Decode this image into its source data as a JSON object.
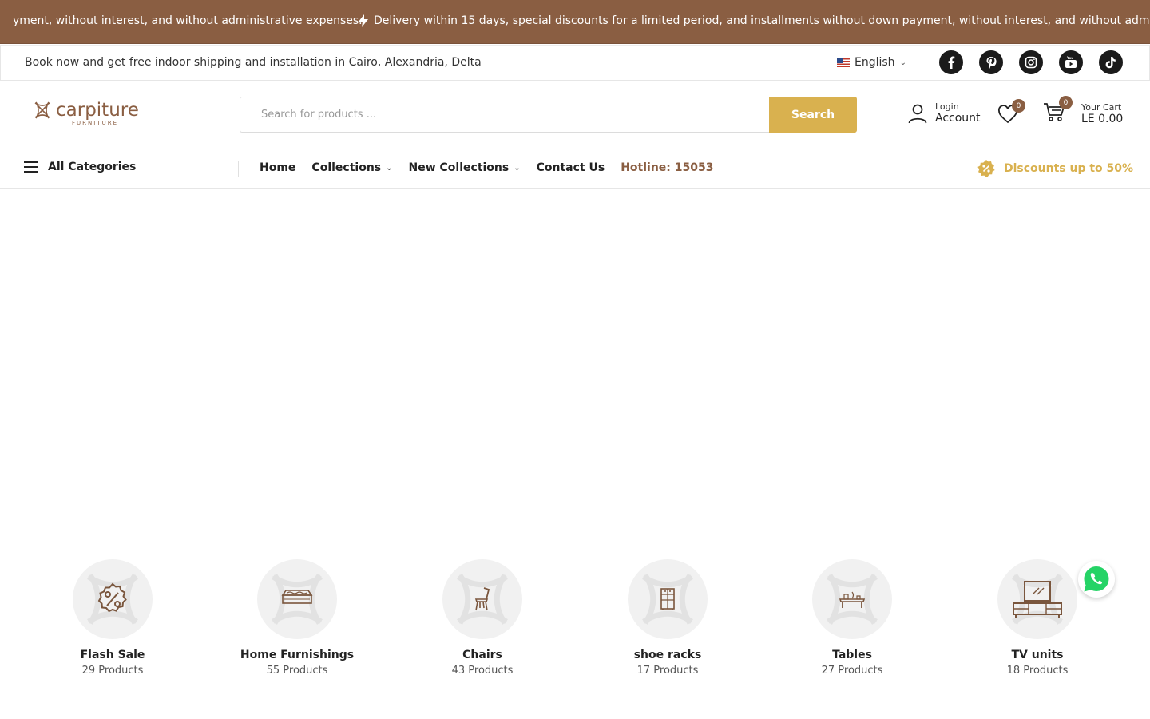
{
  "ticker": {
    "text_left": "yment, without interest, and without administrative expenses.",
    "text_right": "Delivery within 15 days, special discounts for a limited period, and installments without down payment, without interest, and without administrative"
  },
  "topbar": {
    "message": "Book now and get free indoor shipping and installation in Cairo, Alexandria, Delta",
    "language": "English",
    "socials": [
      "facebook-icon",
      "pinterest-icon",
      "instagram-icon",
      "youtube-icon",
      "tiktok-icon"
    ]
  },
  "header": {
    "logo_text": "carpiture",
    "logo_sub": "FURNITURE",
    "search_placeholder": "Search for products ...",
    "search_button": "Search",
    "account_line1": "Login",
    "account_line2": "Account",
    "wishlist_count": "0",
    "cart_count": "0",
    "cart_line1": "Your Cart",
    "cart_total": "LE 0.00"
  },
  "nav": {
    "all_categories": "All Categories",
    "items": [
      {
        "label": "Home",
        "dropdown": false
      },
      {
        "label": "Collections",
        "dropdown": true
      },
      {
        "label": "New Collections",
        "dropdown": true
      },
      {
        "label": "Contact Us",
        "dropdown": false
      },
      {
        "label": "Hotline: 15053",
        "dropdown": false
      }
    ],
    "discount": "Discounts up to 50%"
  },
  "categories": [
    {
      "name": "Flash Sale",
      "count": "29 Products",
      "icon": "percent-badge-icon"
    },
    {
      "name": "Home Furnishings",
      "count": "55 Products",
      "icon": "mattress-icon"
    },
    {
      "name": "Chairs",
      "count": "43 Products",
      "icon": "chair-icon"
    },
    {
      "name": "shoe racks",
      "count": "17 Products",
      "icon": "shoe-rack-icon"
    },
    {
      "name": "Tables",
      "count": "27 Products",
      "icon": "table-icon"
    },
    {
      "name": "TV units",
      "count": "18 Products",
      "icon": "tv-unit-icon"
    }
  ],
  "colors": {
    "brand_brown": "#8a5e42",
    "accent_gold": "#d9b14f"
  }
}
